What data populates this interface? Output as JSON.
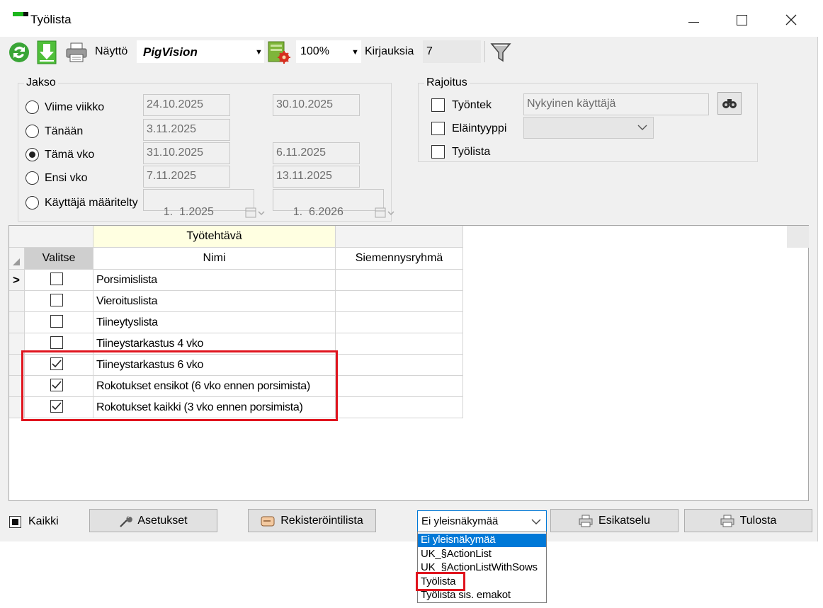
{
  "window": {
    "title": "Työlista"
  },
  "toolbar": {
    "display_label": "Näyttö",
    "display_value": "PigVision",
    "zoom_value": "100%",
    "records_label": "Kirjauksia",
    "records_count": "7"
  },
  "period": {
    "title": "Jakso",
    "options": [
      {
        "label": "Viime viikko",
        "start": "24.10.2025",
        "end": "30.10.2025",
        "selected": false
      },
      {
        "label": "Tänään",
        "start": "3.11.2025",
        "end": "",
        "selected": false
      },
      {
        "label": "Tämä vko",
        "start": "31.10.2025",
        "end": "6.11.2025",
        "selected": true
      },
      {
        "label": "Ensi vko",
        "start": "7.11.2025",
        "end": "13.11.2025",
        "selected": false
      },
      {
        "label": "Käyttäjä määritelty",
        "start": "1.  1.2025",
        "end": "1.  6.2026",
        "selected": false
      }
    ]
  },
  "restriction": {
    "title": "Rajoitus",
    "employee_label": "Työntek",
    "employee_value": "Nykyinen käyttäjä",
    "animal_type_label": "Eläintyyppi",
    "worklist_label": "Työlista"
  },
  "grid": {
    "group_header": "Työtehtävä",
    "col_select": "Valitse",
    "col_name": "Nimi",
    "col_group": "Siemennysryhmä",
    "rows": [
      {
        "name": "Porsimislista",
        "checked": false,
        "current": true
      },
      {
        "name": "Vieroituslista",
        "checked": false,
        "current": false
      },
      {
        "name": "Tiineytyslista",
        "checked": false,
        "current": false
      },
      {
        "name": "Tiineystarkastus 4 vko",
        "checked": false,
        "current": false
      },
      {
        "name": "Tiineystarkastus 6 vko",
        "checked": true,
        "current": false
      },
      {
        "name": "Rokotukset ensikot (6 vko ennen porsimista)",
        "checked": true,
        "current": false
      },
      {
        "name": "Rokotukset kaikki (3 vko ennen porsimista)",
        "checked": true,
        "current": false
      }
    ]
  },
  "bottom": {
    "all_label": "Kaikki",
    "settings_label": "Asetukset",
    "register_label": "Rekisteröintilista",
    "view_selected": "Ei yleisnäkymää",
    "preview_label": "Esikatselu",
    "print_label": "Tulosta"
  },
  "dropdown": {
    "items": [
      "Ei yleisnäkymää",
      "UK_§ActionList",
      "UK_§ActionListWithSows",
      "Työlista",
      "Työlista sis. emakot"
    ],
    "highlight_index": 0
  },
  "colors": {
    "highlight_box": "#e0141e",
    "selection": "#0078d7",
    "group_header_bg": "#ffffe1"
  }
}
